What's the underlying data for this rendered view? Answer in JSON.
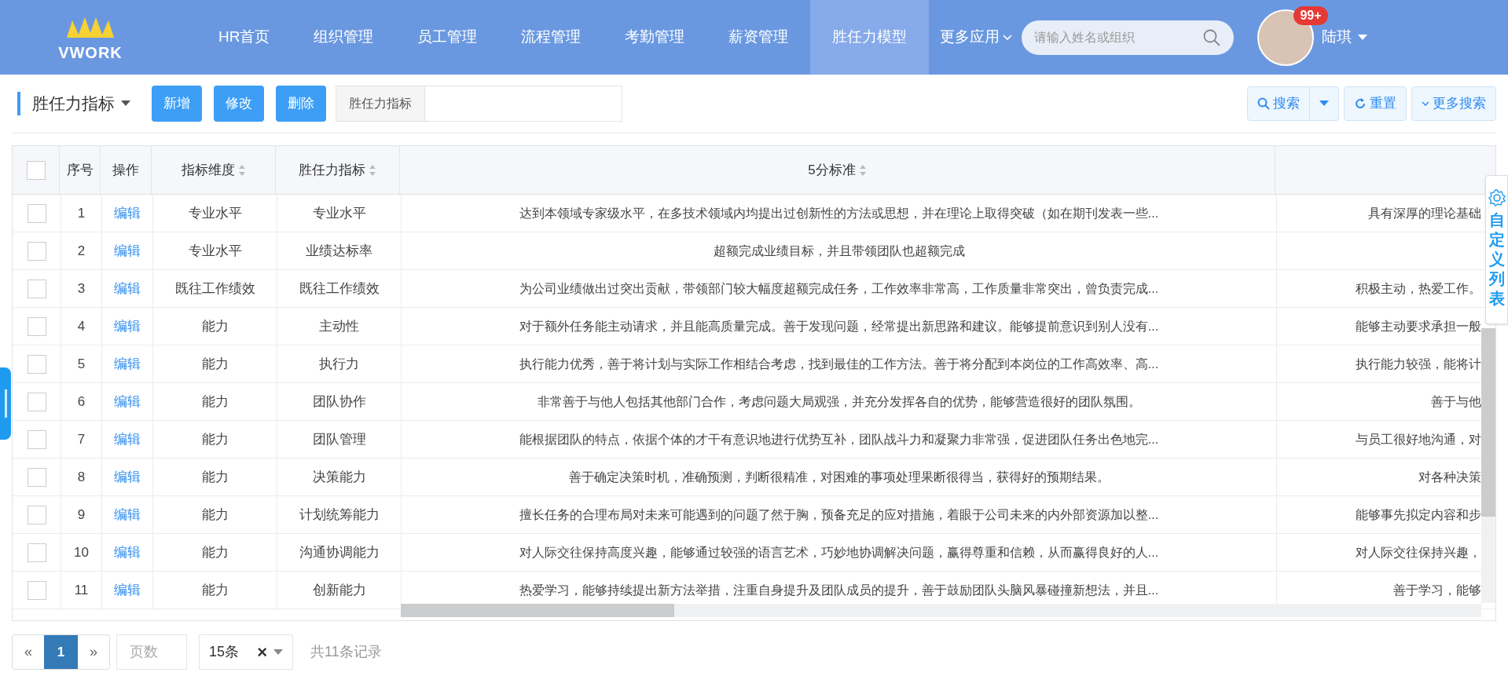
{
  "header": {
    "logo": "VWORK",
    "nav": [
      {
        "label": "HR首页",
        "selected": false
      },
      {
        "label": "组织管理",
        "selected": false
      },
      {
        "label": "员工管理",
        "selected": false
      },
      {
        "label": "流程管理",
        "selected": false
      },
      {
        "label": "考勤管理",
        "selected": false
      },
      {
        "label": "薪资管理",
        "selected": false
      },
      {
        "label": "胜任力模型",
        "selected": true
      },
      {
        "label": "更多应用",
        "selected": false,
        "dropdown": true
      }
    ],
    "search": {
      "placeholder": "请输入姓名或组织"
    },
    "badge": "99+",
    "user": "陆琪"
  },
  "toolbar": {
    "title": "胜任力指标",
    "buttons": [
      "新增",
      "修改",
      "删除"
    ],
    "filter_label": "胜任力指标",
    "search": "搜索",
    "reset": "重置",
    "more_search": "更多搜索"
  },
  "table": {
    "select_all_checked": false,
    "columns": [
      "序号",
      "操作",
      "指标维度",
      "胜任力指标",
      "5分标准"
    ],
    "rows": [
      {
        "index": "1",
        "action": "编辑",
        "dimension": "专业水平",
        "indicator": "专业水平",
        "standard_5": "达到本领域专家级水平，在多技术领域内均提出过创新性的方法或思想，并在理论上取得突破（如在期刊发表一些...",
        "column_6": "具有深厚的理论基础",
        "checked": false
      },
      {
        "index": "2",
        "action": "编辑",
        "dimension": "专业水平",
        "indicator": "业绩达标率",
        "standard_5": "超额完成业绩目标，并且带领团队也超额完成",
        "checked": false
      },
      {
        "index": "3",
        "action": "编辑",
        "dimension": "既往工作绩效",
        "indicator": "既往工作绩效",
        "standard_5": "为公司业绩做出过突出贡献，带领部门较大幅度超额完成任务，工作效率非常高，工作质量非常突出，曾负责完成...",
        "column_6": "积极主动，热爱工作。",
        "checked": false
      },
      {
        "index": "4",
        "action": "编辑",
        "dimension": "能力",
        "indicator": "主动性",
        "standard_5": "对于额外任务能主动请求，并且能高质量完成。善于发现问题，经常提出新思路和建议。能够提前意识到别人没有...",
        "column_6": "能够主动要求承担一般",
        "checked": false
      },
      {
        "index": "5",
        "action": "编辑",
        "dimension": "能力",
        "indicator": "执行力",
        "standard_5": "执行能力优秀，善于将计划与实际工作相结合考虑，找到最佳的工作方法。善于将分配到本岗位的工作高效率、高...",
        "column_6": "执行能力较强，能将计",
        "checked": false
      },
      {
        "index": "6",
        "action": "编辑",
        "dimension": "能力",
        "indicator": "团队协作",
        "standard_5": "非常善于与他人包括其他部门合作，考虑问题大局观强，并充分发挥各自的优势，能够营造很好的团队氛围。",
        "column_6": "善于与他",
        "checked": false
      },
      {
        "index": "7",
        "action": "编辑",
        "dimension": "能力",
        "indicator": "团队管理",
        "standard_5": "能根据团队的特点，依据个体的才干有意识地进行优势互补，团队战斗力和凝聚力非常强，促进团队任务出色地完...",
        "column_6": "与员工很好地沟通，对",
        "checked": false
      },
      {
        "index": "8",
        "action": "编辑",
        "dimension": "能力",
        "indicator": "决策能力",
        "standard_5": "善于确定决策时机，准确预测，判断很精准，对困难的事项处理果断很得当，获得好的预期结果。",
        "column_6": "对各种决策",
        "checked": false
      },
      {
        "index": "9",
        "action": "编辑",
        "dimension": "能力",
        "indicator": "计划统筹能力",
        "standard_5": "擅长任务的合理布局对未来可能遇到的问题了然于胸，预备充足的应对措施，着眼于公司未来的内外部资源加以整...",
        "column_6": "能够事先拟定内容和步",
        "checked": false
      },
      {
        "index": "10",
        "action": "编辑",
        "dimension": "能力",
        "indicator": "沟通协调能力",
        "standard_5": "对人际交往保持高度兴趣，能够通过较强的语言艺术，巧妙地协调解决问题，赢得尊重和信赖，从而赢得良好的人...",
        "column_6": "对人际交往保持兴趣，",
        "checked": false
      },
      {
        "index": "11",
        "action": "编辑",
        "dimension": "能力",
        "indicator": "创新能力",
        "standard_5": "热爱学习，能够持续提出新方法举措，注重自身提升及团队成员的提升，善于鼓励团队头脑风暴碰撞新想法，并且...",
        "column_6": "善于学习，能够",
        "checked": false
      }
    ]
  },
  "side_tab": "自定义列表",
  "pagination": {
    "prev": "«",
    "pages": [
      {
        "label": "1",
        "selected": true
      }
    ],
    "next": "»",
    "page_input_placeholder": "页数",
    "page_size": "15条",
    "clear": "×",
    "total": "共11条记录"
  }
}
